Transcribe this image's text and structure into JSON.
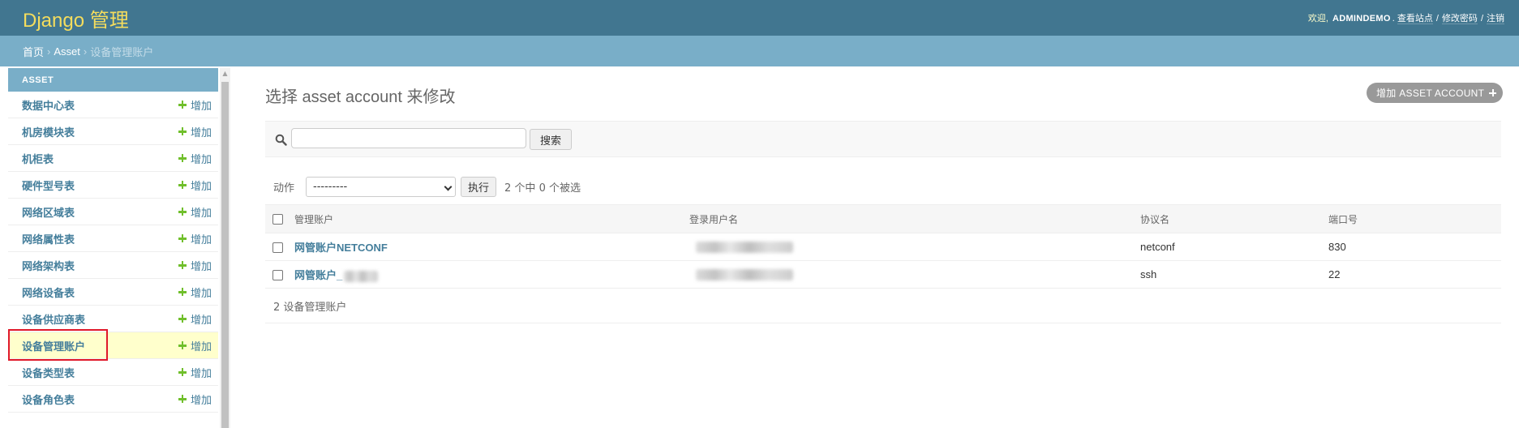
{
  "header": {
    "brand": "Django 管理",
    "welcome": "欢迎,",
    "username": "ADMINDEMO",
    "links": [
      "查看站点",
      "修改密码",
      "注销"
    ]
  },
  "breadcrumbs": {
    "home": "首页",
    "app": "Asset",
    "current": "设备管理账户"
  },
  "sidebar": {
    "caption": "ASSET",
    "add_label": "增加",
    "items": [
      {
        "label": "数据中心表"
      },
      {
        "label": "机房模块表"
      },
      {
        "label": "机柜表"
      },
      {
        "label": "硬件型号表"
      },
      {
        "label": "网络区域表"
      },
      {
        "label": "网络属性表"
      },
      {
        "label": "网络架构表"
      },
      {
        "label": "网络设备表"
      },
      {
        "label": "设备供应商表"
      },
      {
        "label": "设备管理账户",
        "current": true
      },
      {
        "label": "设备类型表"
      },
      {
        "label": "设备角色表"
      }
    ]
  },
  "main": {
    "title": "选择 asset account 来修改",
    "add_button": "增加 ASSET ACCOUNT",
    "search": {
      "value": "",
      "placeholder": "",
      "button": "搜索",
      "icon": "search-icon"
    },
    "actions": {
      "label": "动作",
      "selected": "---------",
      "run_button": "执行",
      "counter": "2 个中 0 个被选"
    },
    "table": {
      "columns": [
        "管理账户",
        "登录用户名",
        "协议名",
        "端口号"
      ],
      "rows": [
        {
          "name": "网管账户NETCONF",
          "username": "",
          "protocol": "netconf",
          "port": "830"
        },
        {
          "name": "网管账户_",
          "username": "",
          "protocol": "ssh",
          "port": "22"
        }
      ]
    },
    "paginator": "2 设备管理账户"
  },
  "colors": {
    "header_bg": "#417690",
    "brand_text": "#f5dd5d",
    "breadcrumb_bg": "#79aec8",
    "link": "#447e9b",
    "add_plus": "#70bf2b",
    "highlight_box": "#e0192a",
    "current_row_bg": "#ffffcc"
  }
}
